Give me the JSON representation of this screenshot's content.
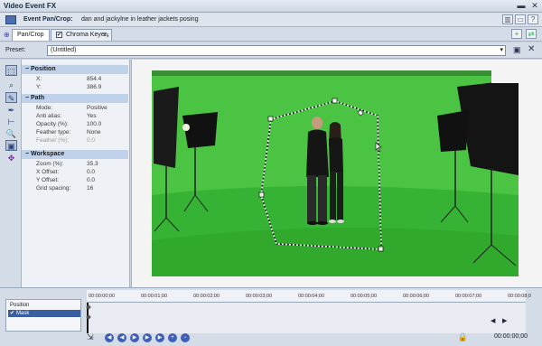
{
  "window": {
    "title": "Video Event FX"
  },
  "event": {
    "label": "Event Pan/Crop:",
    "name": "dan and jackylne in leather jackets posing"
  },
  "tabs": [
    {
      "label": "Pan/Crop"
    },
    {
      "label": "Chroma Keyer"
    }
  ],
  "preset": {
    "label": "Preset:",
    "value": "(Untitled)"
  },
  "properties": {
    "position": {
      "header": "Position",
      "rows": [
        {
          "k": "X:",
          "v": "854.4"
        },
        {
          "k": "Y:",
          "v": "386.9"
        }
      ]
    },
    "path": {
      "header": "Path",
      "rows": [
        {
          "k": "Mode:",
          "v": "Positive"
        },
        {
          "k": "Anti alias:",
          "v": "Yes"
        },
        {
          "k": "Opacity (%):",
          "v": "100.0"
        },
        {
          "k": "Feather type:",
          "v": "None"
        },
        {
          "k": "Feather (%):",
          "v": "0.0"
        }
      ]
    },
    "workspace": {
      "header": "Workspace",
      "rows": [
        {
          "k": "Zoom (%):",
          "v": "35.3"
        },
        {
          "k": "X Offset:",
          "v": "0.0"
        },
        {
          "k": "Y Offset:",
          "v": "0.0"
        },
        {
          "k": "Grid spacing:",
          "v": "16"
        }
      ]
    }
  },
  "timeline": {
    "tracks": [
      {
        "label": "Position"
      },
      {
        "label": "Mask"
      }
    ],
    "ticks": [
      "00:00:00;00",
      "00:00:01;00",
      "00:00:02;00",
      "00:00:03;00",
      "00:00:04;00",
      "00:00:05;00",
      "00:00:06;00",
      "00:00:07;00",
      "00:00:08;0"
    ],
    "timecode": "00:00:00;00"
  },
  "colors": {
    "greenscreen": "#3fbf3a",
    "accent": "#3a5fa0"
  }
}
